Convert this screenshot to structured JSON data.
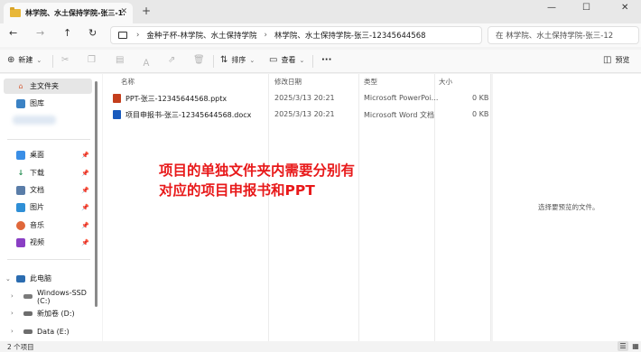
{
  "tab": {
    "title": "林学院、水土保持学院-张三-12",
    "close": "✕",
    "new_tab": "+"
  },
  "window": {
    "minimize": "—",
    "maximize": "☐",
    "close": "✕"
  },
  "nav": {
    "back": "←",
    "forward": "→",
    "up": "↑",
    "refresh": "↻"
  },
  "address": {
    "chevron": "›",
    "crumbs": [
      "金种子杯-林学院、水土保持学院",
      "林学院、水土保持学院-张三-12345644568"
    ]
  },
  "search": {
    "placeholder": "在 林学院、水土保持学院-张三-12"
  },
  "toolbar": {
    "new_label": "新建",
    "sort_label": "排序",
    "view_label": "查看",
    "more_label": "···",
    "details_label": "预览"
  },
  "sidebar": {
    "items": [
      {
        "label": "主文件夹"
      },
      {
        "label": "图库"
      },
      {
        "label": "桌面"
      },
      {
        "label": "下载"
      },
      {
        "label": "文档"
      },
      {
        "label": "图片"
      },
      {
        "label": "音乐"
      },
      {
        "label": "视频"
      },
      {
        "label": "此电脑"
      },
      {
        "label": "Windows-SSD (C:)"
      },
      {
        "label": "新加卷 (D:)"
      },
      {
        "label": "Data (E:)"
      }
    ]
  },
  "columns": {
    "name": "名称",
    "modified": "修改日期",
    "type": "类型",
    "size": "大小"
  },
  "files": [
    {
      "name": "PPT-张三-12345644568.pptx",
      "modified": "2025/3/13 20:21",
      "type": "Microsoft PowerPoi...",
      "size": "0 KB",
      "icon_color": "#c43e1c"
    },
    {
      "name": "项目申报书-张三-12345644568.docx",
      "modified": "2025/3/13 20:21",
      "type": "Microsoft Word 文档",
      "size": "0 KB",
      "icon_color": "#185abd"
    }
  ],
  "annotation": {
    "line1": "项目的单独文件夹内需要分别有",
    "line2": "对应的项目申报书和PPT"
  },
  "preview": {
    "message": "选择要预览的文件。"
  },
  "status": {
    "count": "2 个项目"
  }
}
